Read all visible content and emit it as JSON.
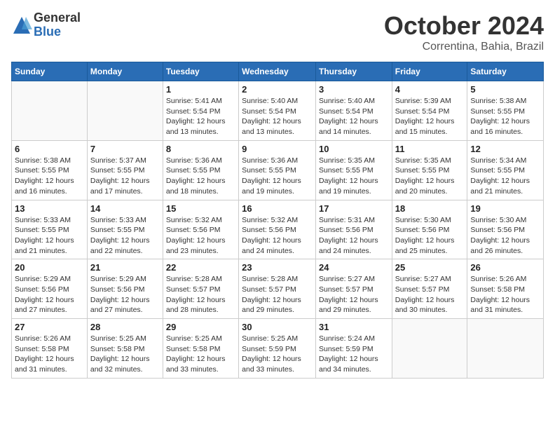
{
  "header": {
    "logo_general": "General",
    "logo_blue": "Blue",
    "month_title": "October 2024",
    "location": "Correntina, Bahia, Brazil"
  },
  "weekdays": [
    "Sunday",
    "Monday",
    "Tuesday",
    "Wednesday",
    "Thursday",
    "Friday",
    "Saturday"
  ],
  "weeks": [
    [
      {
        "day": "",
        "sunrise": "",
        "sunset": "",
        "daylight": ""
      },
      {
        "day": "",
        "sunrise": "",
        "sunset": "",
        "daylight": ""
      },
      {
        "day": "1",
        "sunrise": "Sunrise: 5:41 AM",
        "sunset": "Sunset: 5:54 PM",
        "daylight": "Daylight: 12 hours and 13 minutes."
      },
      {
        "day": "2",
        "sunrise": "Sunrise: 5:40 AM",
        "sunset": "Sunset: 5:54 PM",
        "daylight": "Daylight: 12 hours and 13 minutes."
      },
      {
        "day": "3",
        "sunrise": "Sunrise: 5:40 AM",
        "sunset": "Sunset: 5:54 PM",
        "daylight": "Daylight: 12 hours and 14 minutes."
      },
      {
        "day": "4",
        "sunrise": "Sunrise: 5:39 AM",
        "sunset": "Sunset: 5:54 PM",
        "daylight": "Daylight: 12 hours and 15 minutes."
      },
      {
        "day": "5",
        "sunrise": "Sunrise: 5:38 AM",
        "sunset": "Sunset: 5:55 PM",
        "daylight": "Daylight: 12 hours and 16 minutes."
      }
    ],
    [
      {
        "day": "6",
        "sunrise": "Sunrise: 5:38 AM",
        "sunset": "Sunset: 5:55 PM",
        "daylight": "Daylight: 12 hours and 16 minutes."
      },
      {
        "day": "7",
        "sunrise": "Sunrise: 5:37 AM",
        "sunset": "Sunset: 5:55 PM",
        "daylight": "Daylight: 12 hours and 17 minutes."
      },
      {
        "day": "8",
        "sunrise": "Sunrise: 5:36 AM",
        "sunset": "Sunset: 5:55 PM",
        "daylight": "Daylight: 12 hours and 18 minutes."
      },
      {
        "day": "9",
        "sunrise": "Sunrise: 5:36 AM",
        "sunset": "Sunset: 5:55 PM",
        "daylight": "Daylight: 12 hours and 19 minutes."
      },
      {
        "day": "10",
        "sunrise": "Sunrise: 5:35 AM",
        "sunset": "Sunset: 5:55 PM",
        "daylight": "Daylight: 12 hours and 19 minutes."
      },
      {
        "day": "11",
        "sunrise": "Sunrise: 5:35 AM",
        "sunset": "Sunset: 5:55 PM",
        "daylight": "Daylight: 12 hours and 20 minutes."
      },
      {
        "day": "12",
        "sunrise": "Sunrise: 5:34 AM",
        "sunset": "Sunset: 5:55 PM",
        "daylight": "Daylight: 12 hours and 21 minutes."
      }
    ],
    [
      {
        "day": "13",
        "sunrise": "Sunrise: 5:33 AM",
        "sunset": "Sunset: 5:55 PM",
        "daylight": "Daylight: 12 hours and 21 minutes."
      },
      {
        "day": "14",
        "sunrise": "Sunrise: 5:33 AM",
        "sunset": "Sunset: 5:55 PM",
        "daylight": "Daylight: 12 hours and 22 minutes."
      },
      {
        "day": "15",
        "sunrise": "Sunrise: 5:32 AM",
        "sunset": "Sunset: 5:56 PM",
        "daylight": "Daylight: 12 hours and 23 minutes."
      },
      {
        "day": "16",
        "sunrise": "Sunrise: 5:32 AM",
        "sunset": "Sunset: 5:56 PM",
        "daylight": "Daylight: 12 hours and 24 minutes."
      },
      {
        "day": "17",
        "sunrise": "Sunrise: 5:31 AM",
        "sunset": "Sunset: 5:56 PM",
        "daylight": "Daylight: 12 hours and 24 minutes."
      },
      {
        "day": "18",
        "sunrise": "Sunrise: 5:30 AM",
        "sunset": "Sunset: 5:56 PM",
        "daylight": "Daylight: 12 hours and 25 minutes."
      },
      {
        "day": "19",
        "sunrise": "Sunrise: 5:30 AM",
        "sunset": "Sunset: 5:56 PM",
        "daylight": "Daylight: 12 hours and 26 minutes."
      }
    ],
    [
      {
        "day": "20",
        "sunrise": "Sunrise: 5:29 AM",
        "sunset": "Sunset: 5:56 PM",
        "daylight": "Daylight: 12 hours and 27 minutes."
      },
      {
        "day": "21",
        "sunrise": "Sunrise: 5:29 AM",
        "sunset": "Sunset: 5:56 PM",
        "daylight": "Daylight: 12 hours and 27 minutes."
      },
      {
        "day": "22",
        "sunrise": "Sunrise: 5:28 AM",
        "sunset": "Sunset: 5:57 PM",
        "daylight": "Daylight: 12 hours and 28 minutes."
      },
      {
        "day": "23",
        "sunrise": "Sunrise: 5:28 AM",
        "sunset": "Sunset: 5:57 PM",
        "daylight": "Daylight: 12 hours and 29 minutes."
      },
      {
        "day": "24",
        "sunrise": "Sunrise: 5:27 AM",
        "sunset": "Sunset: 5:57 PM",
        "daylight": "Daylight: 12 hours and 29 minutes."
      },
      {
        "day": "25",
        "sunrise": "Sunrise: 5:27 AM",
        "sunset": "Sunset: 5:57 PM",
        "daylight": "Daylight: 12 hours and 30 minutes."
      },
      {
        "day": "26",
        "sunrise": "Sunrise: 5:26 AM",
        "sunset": "Sunset: 5:58 PM",
        "daylight": "Daylight: 12 hours and 31 minutes."
      }
    ],
    [
      {
        "day": "27",
        "sunrise": "Sunrise: 5:26 AM",
        "sunset": "Sunset: 5:58 PM",
        "daylight": "Daylight: 12 hours and 31 minutes."
      },
      {
        "day": "28",
        "sunrise": "Sunrise: 5:25 AM",
        "sunset": "Sunset: 5:58 PM",
        "daylight": "Daylight: 12 hours and 32 minutes."
      },
      {
        "day": "29",
        "sunrise": "Sunrise: 5:25 AM",
        "sunset": "Sunset: 5:58 PM",
        "daylight": "Daylight: 12 hours and 33 minutes."
      },
      {
        "day": "30",
        "sunrise": "Sunrise: 5:25 AM",
        "sunset": "Sunset: 5:59 PM",
        "daylight": "Daylight: 12 hours and 33 minutes."
      },
      {
        "day": "31",
        "sunrise": "Sunrise: 5:24 AM",
        "sunset": "Sunset: 5:59 PM",
        "daylight": "Daylight: 12 hours and 34 minutes."
      },
      {
        "day": "",
        "sunrise": "",
        "sunset": "",
        "daylight": ""
      },
      {
        "day": "",
        "sunrise": "",
        "sunset": "",
        "daylight": ""
      }
    ]
  ]
}
